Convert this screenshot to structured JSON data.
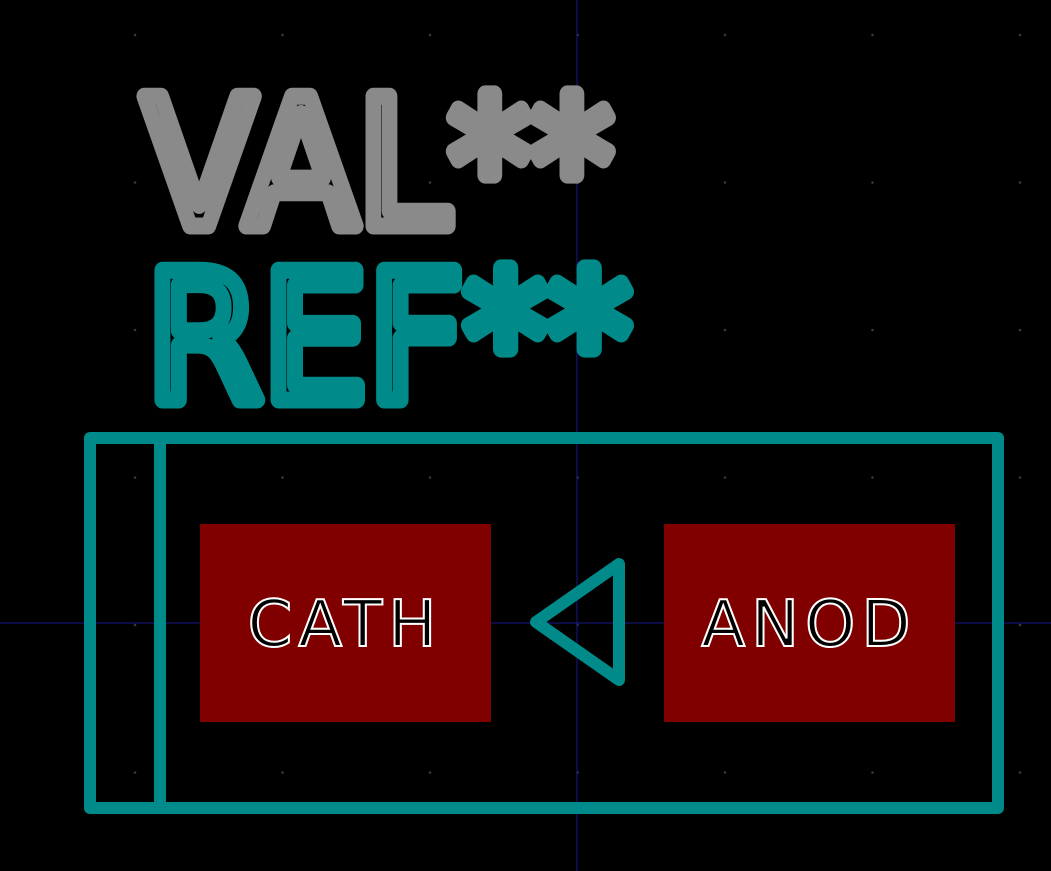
{
  "footprint": {
    "value_label": "VAL**",
    "reference_label": "REF**",
    "pads": [
      {
        "name": "CATH"
      },
      {
        "name": "ANOD"
      }
    ]
  },
  "colors": {
    "background": "#000000",
    "grid_dot": "#3a3a3a",
    "crosshair": "#1a1a8a",
    "value_text": "#8a8a8a",
    "silkscreen": "#008a8a",
    "pad_fill": "#800000",
    "pad_text_fill": "#000000",
    "pad_text_stroke": "#ffffff"
  }
}
